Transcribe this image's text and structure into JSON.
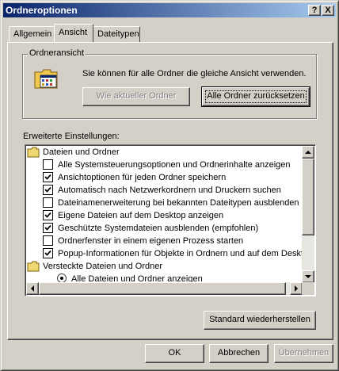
{
  "window": {
    "title": "Ordneroptionen",
    "help_glyph": "?",
    "close_glyph": "X"
  },
  "tabs": [
    {
      "label": "Allgemein",
      "active": false
    },
    {
      "label": "Ansicht",
      "active": true
    },
    {
      "label": "Dateitypen",
      "active": false
    }
  ],
  "folder_view": {
    "legend": "Ordneransicht",
    "description": "Sie können für alle Ordner die gleiche Ansicht verwenden.",
    "icon": "folder-options-icon",
    "apply_button": {
      "label": "Wie aktueller Ordner",
      "enabled": false
    },
    "reset_button": {
      "label": "Alle Ordner zurücksetzen",
      "enabled": true
    }
  },
  "advanced": {
    "label": "Erweiterte Einstellungen:",
    "items": [
      {
        "type": "folder",
        "label": "Dateien und Ordner"
      },
      {
        "type": "checkbox",
        "checked": false,
        "label": "Alle Systemsteuerungsoptionen und Ordnerinhalte anzeigen"
      },
      {
        "type": "checkbox",
        "checked": true,
        "label": "Ansichtoptionen für jeden Ordner speichern"
      },
      {
        "type": "checkbox",
        "checked": true,
        "label": "Automatisch nach Netzwerkordnern und Druckern suchen"
      },
      {
        "type": "checkbox",
        "checked": false,
        "label": "Dateinamenerweiterung bei bekannten Dateitypen ausblenden"
      },
      {
        "type": "checkbox",
        "checked": true,
        "label": "Eigene Dateien auf dem Desktop anzeigen"
      },
      {
        "type": "checkbox",
        "checked": true,
        "label": "Geschützte Systemdateien ausblenden (empfohlen)"
      },
      {
        "type": "checkbox",
        "checked": false,
        "label": "Ordnerfenster in einem eigenen Prozess starten"
      },
      {
        "type": "checkbox",
        "checked": true,
        "label": "Popup-Informationen für Objekte in Ordnern und auf dem Desktop"
      },
      {
        "type": "folder",
        "label": "Versteckte Dateien und Ordner"
      },
      {
        "type": "radio",
        "checked": true,
        "label": "Alle Dateien und Ordner anzeigen"
      }
    ]
  },
  "restore_button": "Standard wiederherstellen",
  "footer": {
    "ok": "OK",
    "cancel": "Abbrechen",
    "apply": "Übernehmen",
    "apply_enabled": false
  },
  "colors": {
    "face": "#d4d0c8",
    "title_start": "#0a246a",
    "title_end": "#a6caf0"
  }
}
